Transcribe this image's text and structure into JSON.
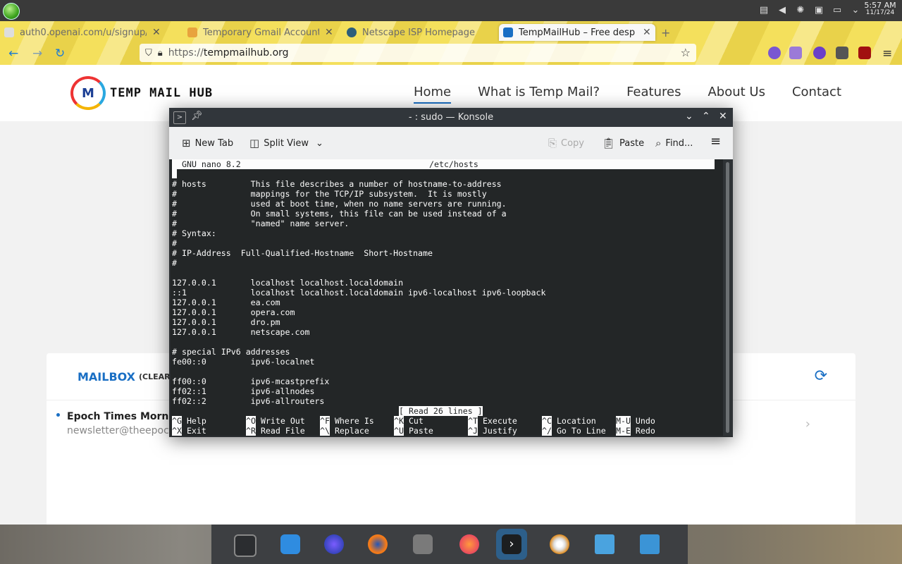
{
  "system": {
    "time": "5:57 AM",
    "date": "11/17/24",
    "tray_icons": [
      "clipboard-icon",
      "volume-muted-icon",
      "brightness-icon",
      "save-icon",
      "display-icon",
      "chevron-down-icon"
    ]
  },
  "browser": {
    "tabs": [
      {
        "label": "auth0.openai.com/u/signup/",
        "icon": "openai-tab-icon",
        "active": false
      },
      {
        "label": "Temporary Gmail Account",
        "icon": "gmail-tab-icon",
        "active": false
      },
      {
        "label": "Netscape ISP Homepage",
        "icon": "netscape-tab-icon",
        "active": false
      },
      {
        "label": "TempMailHub – Free desp",
        "icon": "tempmailhub-tab-icon",
        "active": true
      }
    ],
    "new_tab_symbol": "+",
    "url_protocol": "https://",
    "url_host": "tempmailhub.org"
  },
  "site": {
    "logo_text": "TEMP MAIL HUB",
    "nav": [
      "Home",
      "What is Temp Mail?",
      "Features",
      "About Us",
      "Contact"
    ],
    "mailbox_title": "MAILBOX",
    "mailbox_clear": "(CLEAR",
    "mail": {
      "subject": "Epoch Times Morning I",
      "from": "newsletter@theepoch"
    }
  },
  "konsole": {
    "title": "- : sudo — Konsole",
    "toolbar": {
      "new_tab": "New Tab",
      "split_view": "Split View",
      "copy": "Copy",
      "paste": "Paste",
      "find": "Find..."
    },
    "nano_version": "GNU nano 8.2",
    "file_name": "/etc/hosts",
    "lines": [
      "",
      "# hosts         This file describes a number of hostname-to-address",
      "#               mappings for the TCP/IP subsystem.  It is mostly",
      "#               used at boot time, when no name servers are running.",
      "#               On small systems, this file can be used instead of a",
      "#               \"named\" name server.",
      "# Syntax:",
      "#",
      "# IP-Address  Full-Qualified-Hostname  Short-Hostname",
      "#",
      "",
      "127.0.0.1       localhost localhost.localdomain",
      "::1             localhost localhost.localdomain ipv6-localhost ipv6-loopback",
      "127.0.0.1       ea.com",
      "127.0.0.1       opera.com",
      "127.0.0.1       dro.pm",
      "127.0.0.1       netscape.com",
      "",
      "# special IPv6 addresses",
      "fe00::0         ipv6-localnet",
      "",
      "ff00::0         ipv6-mcastprefix",
      "ff02::1         ipv6-allnodes",
      "ff02::2         ipv6-allrouters"
    ],
    "status": "[ Read 26 lines ]",
    "shortcuts_row1": [
      {
        "key": "^G",
        "label": "Help"
      },
      {
        "key": "^O",
        "label": "Write Out"
      },
      {
        "key": "^F",
        "label": "Where Is"
      },
      {
        "key": "^K",
        "label": "Cut"
      },
      {
        "key": "^T",
        "label": "Execute"
      },
      {
        "key": "^C",
        "label": "Location"
      },
      {
        "key": "M-U",
        "label": "Undo"
      }
    ],
    "shortcuts_row2": [
      {
        "key": "^X",
        "label": "Exit"
      },
      {
        "key": "^R",
        "label": "Read File"
      },
      {
        "key": "^\\",
        "label": "Replace"
      },
      {
        "key": "^U",
        "label": "Paste"
      },
      {
        "key": "^J",
        "label": "Justify"
      },
      {
        "key": "^/",
        "label": "Go To Line"
      },
      {
        "key": "M-E",
        "label": "Redo"
      }
    ]
  },
  "dock": [
    "settings-app-icon",
    "store-app-icon",
    "firefox-nightly-app-icon",
    "firefox-app-icon",
    "editor-app-icon",
    "firefox-alt-app-icon",
    "konsole-app-icon",
    "disc-app-icon",
    "files-app-icon",
    "files-alt-app-icon"
  ]
}
